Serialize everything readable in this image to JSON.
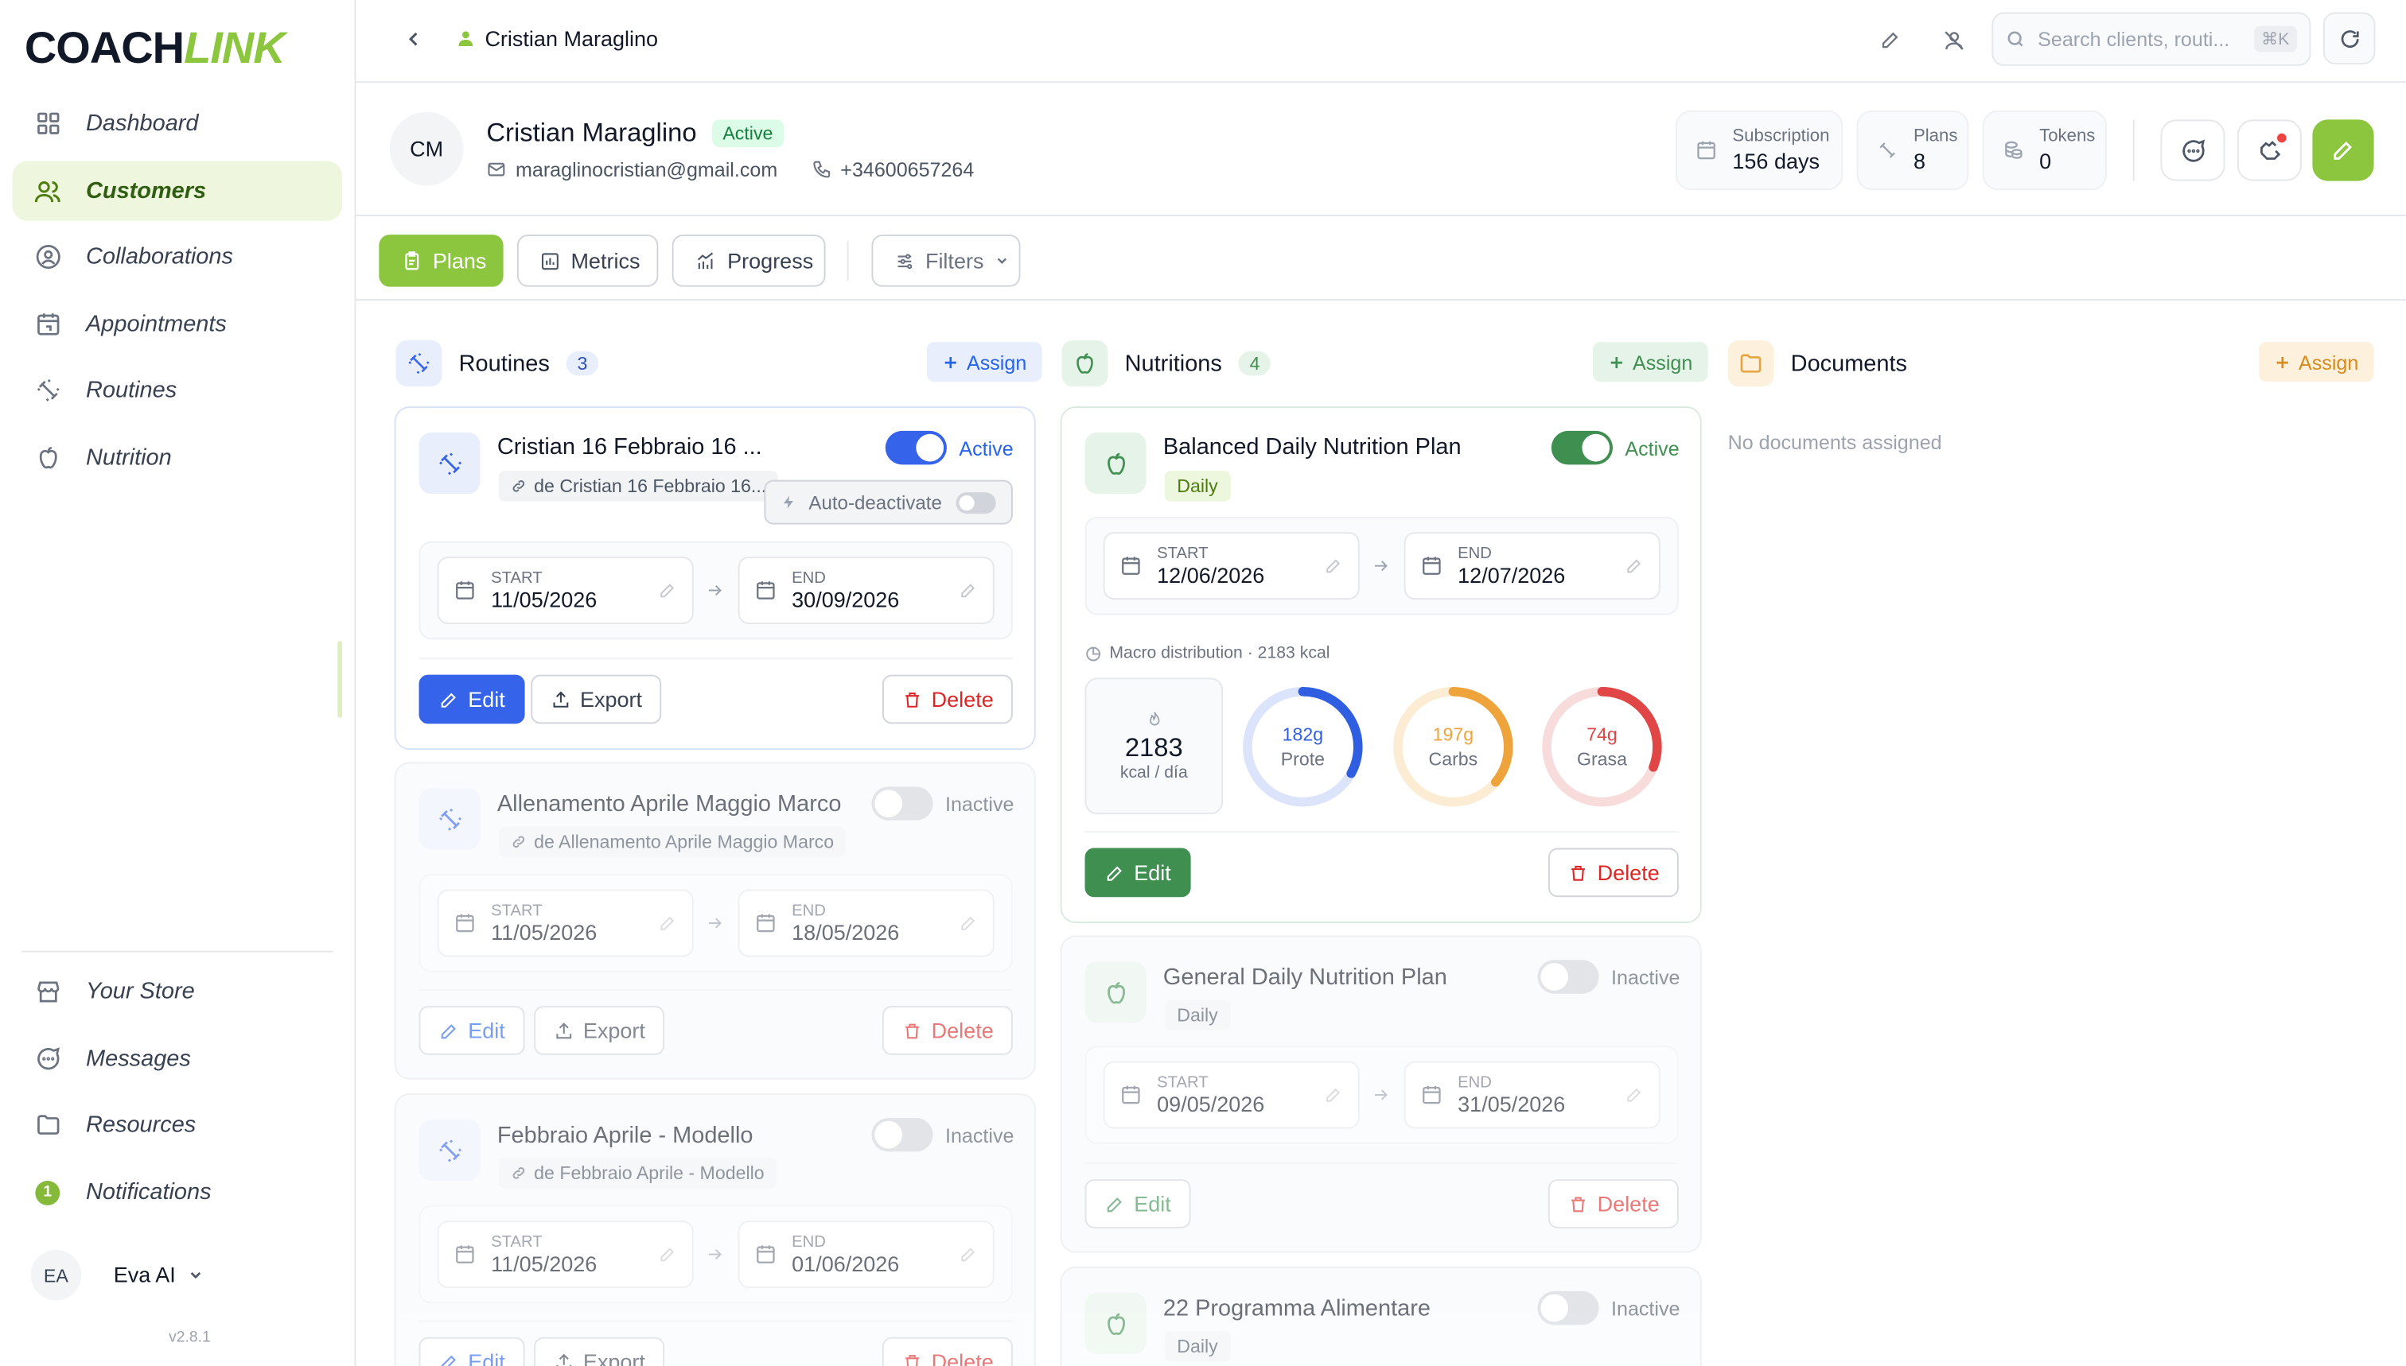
{
  "app": {
    "logo_part1": "COACH",
    "logo_part2": "LINK",
    "version": "v2.8.1"
  },
  "sidebar": {
    "items": [
      {
        "label": "Dashboard",
        "icon": "grid-icon"
      },
      {
        "label": "Customers",
        "icon": "users-icon"
      },
      {
        "label": "Collaborations",
        "icon": "user-circle-icon"
      },
      {
        "label": "Appointments",
        "icon": "calendar-icon"
      },
      {
        "label": "Routines",
        "icon": "dumbbell-icon"
      },
      {
        "label": "Nutrition",
        "icon": "apple-icon"
      }
    ],
    "bottom_items": [
      {
        "label": "Your Store",
        "icon": "store-icon"
      },
      {
        "label": "Messages",
        "icon": "message-icon"
      },
      {
        "label": "Resources",
        "icon": "folder-icon"
      },
      {
        "label": "Notifications",
        "icon": "bell-icon",
        "badge": "1"
      }
    ],
    "user": {
      "initials": "EA",
      "name": "Eva AI"
    }
  },
  "topbar": {
    "breadcrumb_name": "Cristian Maraglino",
    "search_placeholder": "Search clients, routi...",
    "search_shortcut": "⌘K"
  },
  "client": {
    "initials": "CM",
    "name": "Cristian Maraglino",
    "status": "Active",
    "email": "maraglinocristian@gmail.com",
    "phone": "+34600657264",
    "stats": [
      {
        "label": "Subscription",
        "value": "156 days"
      },
      {
        "label": "Plans",
        "value": "8"
      },
      {
        "label": "Tokens",
        "value": "0"
      }
    ]
  },
  "tabs": {
    "plans": "Plans",
    "metrics": "Metrics",
    "progress": "Progress",
    "filters": "Filters"
  },
  "routines": {
    "title": "Routines",
    "count": "3",
    "assign": "Assign",
    "cards": [
      {
        "title": "Cristian 16 Febbraio 16 ...",
        "source": "de Cristian 16 Febbraio 16...",
        "state": "Active",
        "auto": "Auto-deactivate",
        "start_label": "START",
        "start": "11/05/2026",
        "end_label": "END",
        "end": "30/09/2026",
        "edit": "Edit",
        "export": "Export",
        "delete": "Delete"
      },
      {
        "title": "Allenamento Aprile Maggio Marco",
        "source": "de Allenamento Aprile Maggio Marco",
        "state": "Inactive",
        "start_label": "START",
        "start": "11/05/2026",
        "end_label": "END",
        "end": "18/05/2026",
        "edit": "Edit",
        "export": "Export",
        "delete": "Delete"
      },
      {
        "title": "Febbraio Aprile - Modello",
        "source": "de Febbraio Aprile - Modello",
        "state": "Inactive",
        "start_label": "START",
        "start": "11/05/2026",
        "end_label": "END",
        "end": "01/06/2026",
        "edit": "Edit",
        "export": "Export",
        "delete": "Delete"
      }
    ]
  },
  "nutritions": {
    "title": "Nutritions",
    "count": "4",
    "assign": "Assign",
    "cards": [
      {
        "title": "Balanced Daily Nutrition Plan",
        "tag": "Daily",
        "state": "Active",
        "start_label": "START",
        "start": "12/06/2026",
        "end_label": "END",
        "end": "12/07/2026",
        "macro_title": "Macro distribution · 2183 kcal",
        "kcal": "2183",
        "kcal_unit": "kcal / día",
        "macros": [
          {
            "value": "182g",
            "label": "Prote",
            "fraction": 0.33,
            "color": "#2f5fe0",
            "track": "#dbe4fb"
          },
          {
            "value": "197g",
            "label": "Carbs",
            "fraction": 0.36,
            "color": "#eea43b",
            "track": "#fcecd4"
          },
          {
            "value": "74g",
            "label": "Grasa",
            "fraction": 0.31,
            "color": "#e04646",
            "track": "#f8dcdc"
          }
        ],
        "edit": "Edit",
        "delete": "Delete"
      },
      {
        "title": "General Daily Nutrition Plan",
        "tag": "Daily",
        "state": "Inactive",
        "start_label": "START",
        "start": "09/05/2026",
        "end_label": "END",
        "end": "31/05/2026",
        "edit": "Edit",
        "delete": "Delete"
      },
      {
        "title": "22 Programma Alimentare",
        "tag": "Daily",
        "state": "Inactive"
      }
    ]
  },
  "documents": {
    "title": "Documents",
    "assign": "Assign",
    "empty": "No documents assigned"
  },
  "colors": {
    "brand": "#8cc63f",
    "routine_blue": "#3563e9",
    "nutrition_green": "#3f8f50",
    "danger": "#dc2626"
  }
}
